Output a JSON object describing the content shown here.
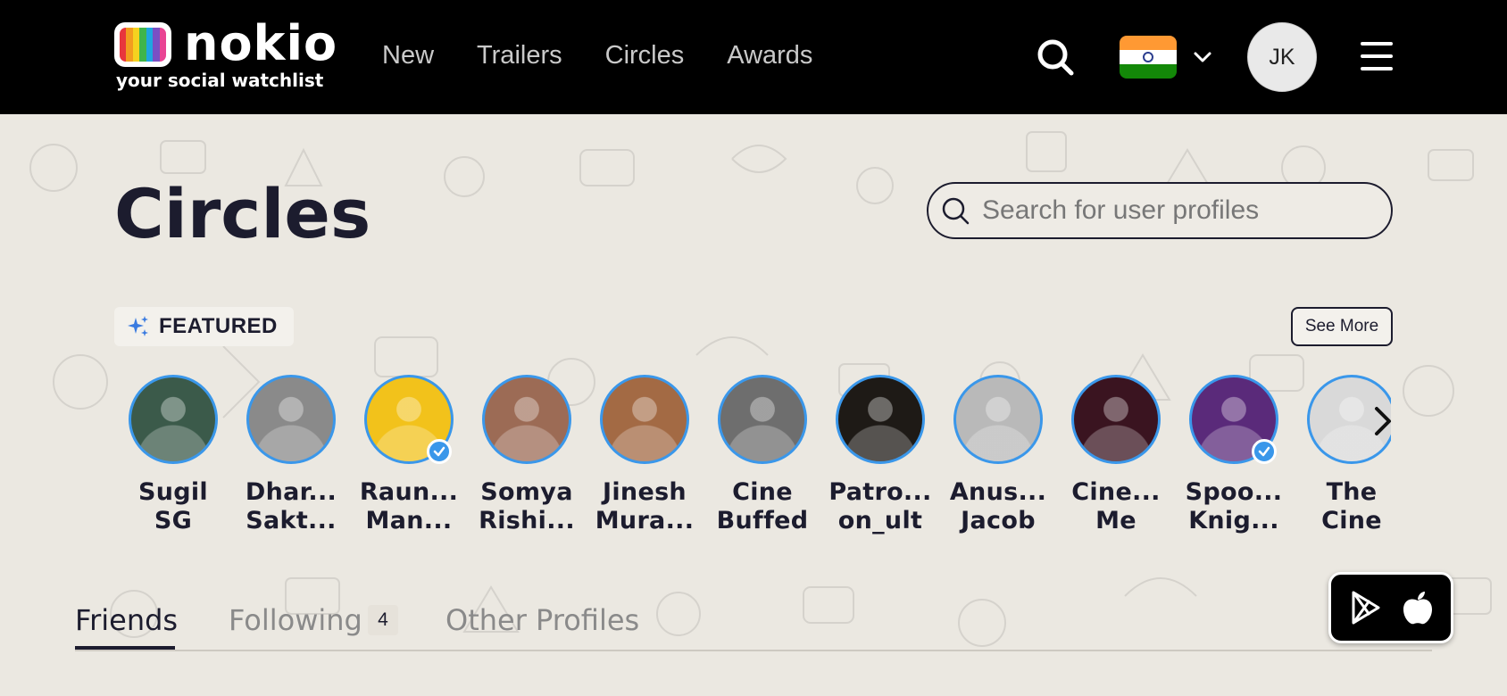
{
  "header": {
    "logo_word": "nokio",
    "logo_tagline": "your social watchlist",
    "nav": [
      "New",
      "Trailers",
      "Circles",
      "Awards"
    ],
    "user_initials": "JK",
    "region_flag": "india-flag-icon"
  },
  "main": {
    "title": "Circles",
    "search_placeholder": "Search for user profiles",
    "featured_label": "FEATURED",
    "see_more_label": "See More",
    "profiles": [
      {
        "line1": "Sugil",
        "line2": "SG",
        "verified": false,
        "bg": "#3b5a4a"
      },
      {
        "line1": "Dhar...",
        "line2": "Sakt...",
        "verified": false,
        "bg": "#8a8a8a"
      },
      {
        "line1": "Raun...",
        "line2": "Man...",
        "verified": true,
        "bg": "#f2c21b"
      },
      {
        "line1": "Somya",
        "line2": "Rishi...",
        "verified": false,
        "bg": "#9c6b55"
      },
      {
        "line1": "Jinesh",
        "line2": "Mura...",
        "verified": false,
        "bg": "#a36a44"
      },
      {
        "line1": "Cine",
        "line2": "Buffed",
        "verified": false,
        "bg": "#6e6e6e"
      },
      {
        "line1": "Patro...",
        "line2": "on_ult",
        "verified": false,
        "bg": "#1e1a16"
      },
      {
        "line1": "Anus...",
        "line2": "Jacob",
        "verified": false,
        "bg": "#b9b9b9"
      },
      {
        "line1": "Cine...",
        "line2": "Me",
        "verified": false,
        "bg": "#3a1420"
      },
      {
        "line1": "Spoo...",
        "line2": "Knig...",
        "verified": true,
        "bg": "#5a2a7a"
      },
      {
        "line1": "The",
        "line2": "Cine",
        "verified": false,
        "bg": "#d9d9d9"
      }
    ],
    "tabs": [
      {
        "label": "Friends",
        "active": true
      },
      {
        "label": "Following",
        "count": "4"
      },
      {
        "label": "Other Profiles"
      }
    ]
  },
  "colors": {
    "accent_blue": "#3a97ea",
    "header_bg": "#000000",
    "page_bg": "#ebe8e1",
    "text_dark": "#1c1c2e"
  },
  "icons": [
    "search-icon",
    "chevron-down-icon",
    "hamburger-menu-icon",
    "sparkle-icon",
    "verified-badge-icon",
    "chevron-right-icon",
    "google-play-icon",
    "apple-icon"
  ]
}
